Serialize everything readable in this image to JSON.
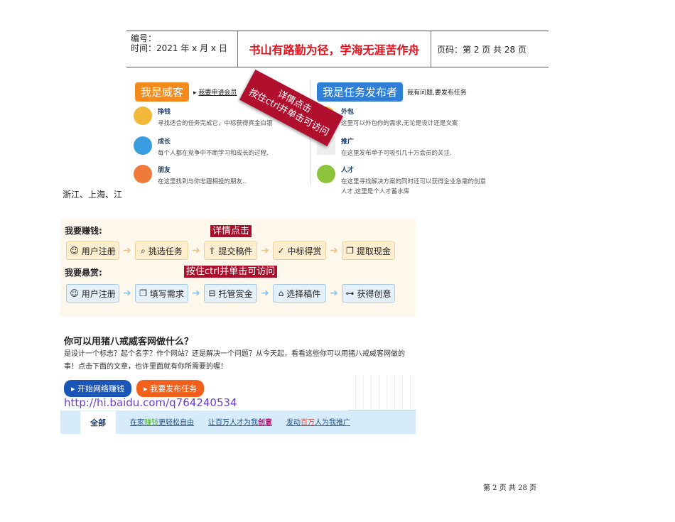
{
  "header": {
    "number_label": "编号：",
    "time_label": "时间：2021 年 x 月 x 日",
    "motto": "书山有路勤为径，学海无涯苦作舟",
    "page_info": "页码：第 2 页  共 28 页"
  },
  "roles": {
    "weike": {
      "tag": "我是威客",
      "link": "我要申请会员",
      "features": [
        {
          "title": "挣钱",
          "desc": "寻找适合的任务完成它，中标获得真金白银"
        },
        {
          "title": "成长",
          "desc": "每个人都在竞争中不断学习和成长的过程."
        },
        {
          "title": "朋友",
          "desc": "在这里找到与你志趣相投的朋友.."
        }
      ]
    },
    "publisher": {
      "tag": "我是任务发布者",
      "link": "我有问题,要发布任务",
      "features": [
        {
          "title": "外包",
          "desc": "这里可以外包你的需求,无论是设计还是文案"
        },
        {
          "title": "推广",
          "desc": "在这里发布单子可吸引几十万会员的关注."
        },
        {
          "title": "人才",
          "desc": "在这里寻找解决方案的同时还可以获得企业急需的创意人才,这里是个人才蓄水库"
        }
      ]
    },
    "ribbon": {
      "line1": "详情点击",
      "line2": "按住ctrl并单击可访问"
    }
  },
  "body_text": "浙江、上海、江",
  "flow": {
    "earn_label": "我要赚钱:",
    "reward_label": "我要悬赏:",
    "badge1": "详情点击",
    "badge2": "按住ctrl并单击可访问",
    "earn_steps": [
      "用户注册",
      "挑选任务",
      "提交稿件",
      "中标得赏",
      "提取现金"
    ],
    "reward_steps": [
      "用户注册",
      "填写需求",
      "托管赏金",
      "选择稿件",
      "获得创意"
    ]
  },
  "promo": {
    "title": "你可以用猪八戒威客网做什么？",
    "desc": "是设计一个标志？起个名字？作个网站？还是解决一个问题？从今天起，看看这些你可以用猪八戒威客网做的事！点击下面的文章，也许里面就有你所需要的喔！",
    "btn_earn": "开始网络赚钱",
    "btn_publish": "我要发布任务",
    "url": "http://hi.baidu.com/q764240534",
    "tabs": {
      "all": "全部",
      "t1": [
        "在家",
        "赚钱",
        "更轻松自由"
      ],
      "t2": [
        "让百万人才为我",
        "创意"
      ],
      "t3": [
        "发动",
        "百万",
        "人为我推广"
      ]
    }
  },
  "footer": "第 2 页 共 28 页"
}
